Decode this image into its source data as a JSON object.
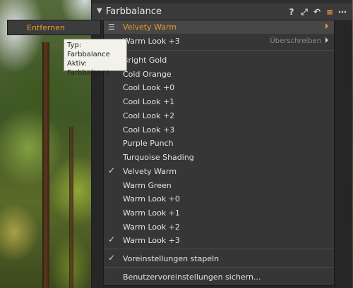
{
  "panel": {
    "title": "Farbbalance"
  },
  "remove_tab": {
    "label": "Entfernen"
  },
  "tooltip": {
    "line1": "Typ: Farbbalance",
    "line2": "Aktiv:",
    "line3": "Farbbalance"
  },
  "menu": {
    "current": "Velvety Warm",
    "stacked": "Warm Look +3",
    "overwrite": "Überschreiben",
    "presets": [
      {
        "label": "Bright Gold",
        "checked": false
      },
      {
        "label": "Cold Orange",
        "checked": false
      },
      {
        "label": "Cool Look +0",
        "checked": false
      },
      {
        "label": "Cool Look +1",
        "checked": false
      },
      {
        "label": "Cool Look +2",
        "checked": false
      },
      {
        "label": "Cool Look +3",
        "checked": false
      },
      {
        "label": "Purple Punch",
        "checked": false
      },
      {
        "label": "Turquoise Shading",
        "checked": false
      },
      {
        "label": "Velvety Warm",
        "checked": true
      },
      {
        "label": "Warm Green",
        "checked": false
      },
      {
        "label": "Warm Look +0",
        "checked": false
      },
      {
        "label": "Warm Look +1",
        "checked": false
      },
      {
        "label": "Warm Look +2",
        "checked": false
      },
      {
        "label": "Warm Look +3",
        "checked": true
      }
    ],
    "stack_presets": "Voreinstellungen stapeln",
    "save_user_presets": "Benutzervoreinstellungen sichern..."
  },
  "colors": {
    "accent": "#e69a2a"
  }
}
